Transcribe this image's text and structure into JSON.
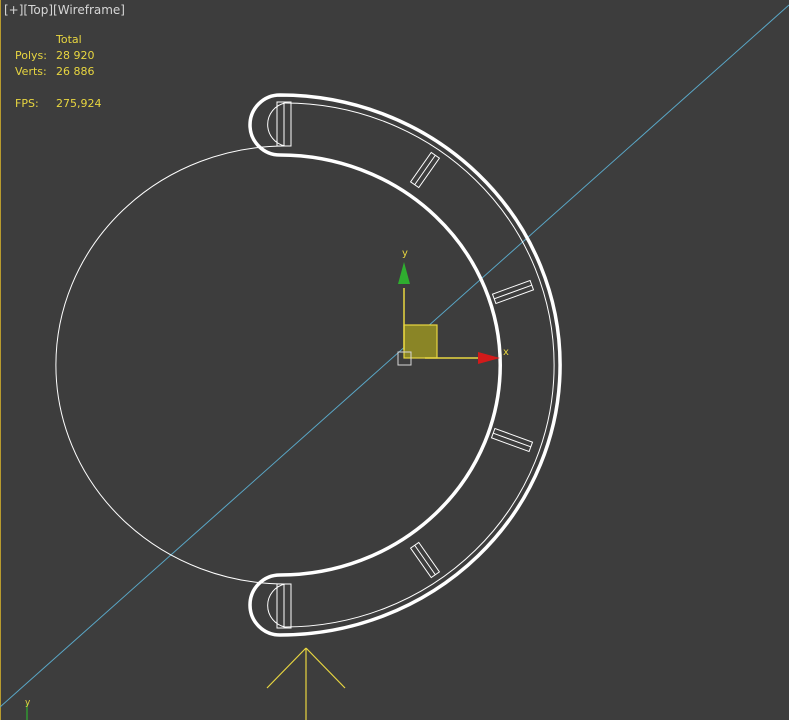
{
  "viewport": {
    "menu_plus": "[+]",
    "view_name": "[Top]",
    "shading": "[Wireframe]"
  },
  "stats": {
    "header": "Total",
    "polys_label": "Polys:",
    "polys_value": "28 920",
    "verts_label": "Verts:",
    "verts_value": "26 886",
    "fps_label": "FPS:",
    "fps_value": "275,924"
  },
  "gizmo": {
    "x_label": "x",
    "y_label": "y"
  },
  "axis_tripod": {
    "y_label": "y"
  },
  "colors": {
    "background": "#3d3d3d",
    "wireframe": "#ffffff",
    "stats_text": "#e8d640",
    "gizmo_x": "#d21a1a",
    "gizmo_y": "#2fae2f",
    "gizmo_plane": "#8a8526",
    "guide_line": "#5aa8c8"
  }
}
